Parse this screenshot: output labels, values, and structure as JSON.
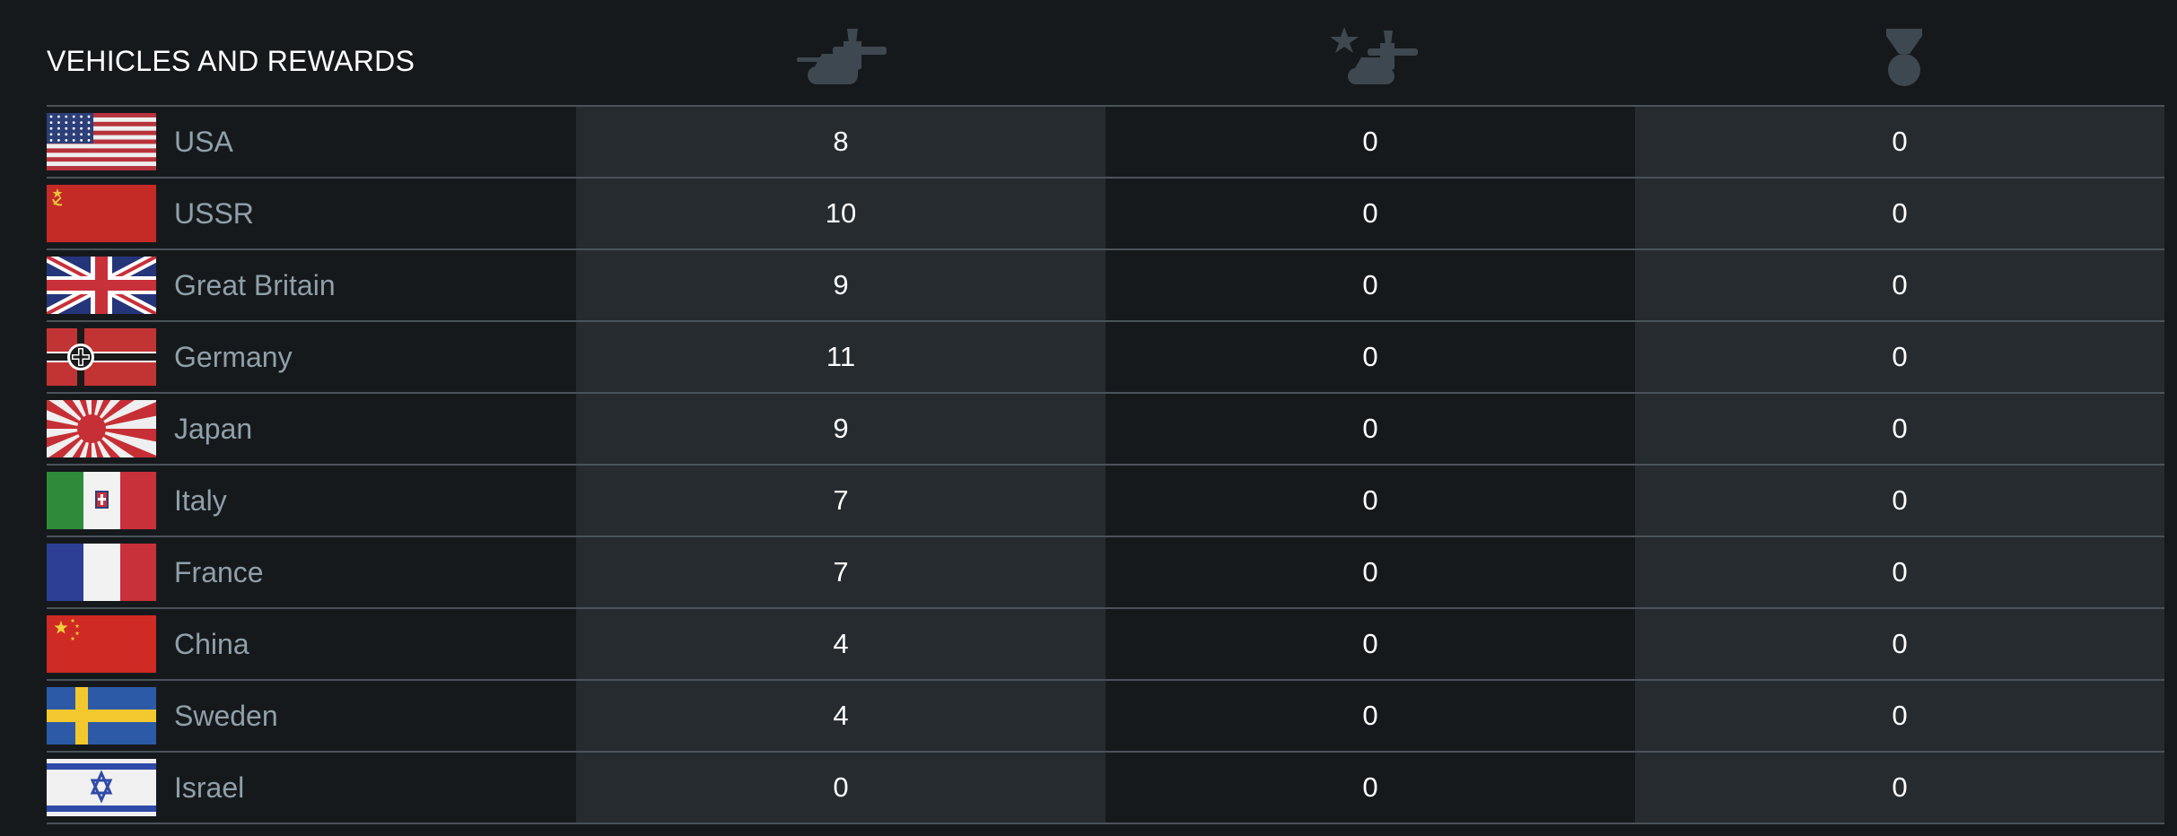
{
  "header": {
    "title": "VEHICLES AND REWARDS",
    "columns": [
      {
        "icon": "researched-vehicles-icon"
      },
      {
        "icon": "premium-vehicles-icon"
      },
      {
        "icon": "medal-icon"
      }
    ],
    "colors": {
      "icon": "#3e4850",
      "divider": "#49535a",
      "stripe": "#252b2f",
      "background": "#16191c",
      "country_text": "#8fa0aa"
    }
  },
  "nations": [
    {
      "name": "USA",
      "flag": "usa-flag-icon",
      "vehicles": "8",
      "premium": "0",
      "rewards": "0"
    },
    {
      "name": "USSR",
      "flag": "ussr-flag-icon",
      "vehicles": "10",
      "premium": "0",
      "rewards": "0"
    },
    {
      "name": "Great Britain",
      "flag": "great-britain-flag-icon",
      "vehicles": "9",
      "premium": "0",
      "rewards": "0"
    },
    {
      "name": "Germany",
      "flag": "germany-flag-icon",
      "vehicles": "11",
      "premium": "0",
      "rewards": "0"
    },
    {
      "name": "Japan",
      "flag": "japan-flag-icon",
      "vehicles": "9",
      "premium": "0",
      "rewards": "0"
    },
    {
      "name": "Italy",
      "flag": "italy-flag-icon",
      "vehicles": "7",
      "premium": "0",
      "rewards": "0"
    },
    {
      "name": "France",
      "flag": "france-flag-icon",
      "vehicles": "7",
      "premium": "0",
      "rewards": "0"
    },
    {
      "name": "China",
      "flag": "china-flag-icon",
      "vehicles": "4",
      "premium": "0",
      "rewards": "0"
    },
    {
      "name": "Sweden",
      "flag": "sweden-flag-icon",
      "vehicles": "4",
      "premium": "0",
      "rewards": "0"
    },
    {
      "name": "Israel",
      "flag": "israel-flag-icon",
      "vehicles": "0",
      "premium": "0",
      "rewards": "0"
    }
  ]
}
